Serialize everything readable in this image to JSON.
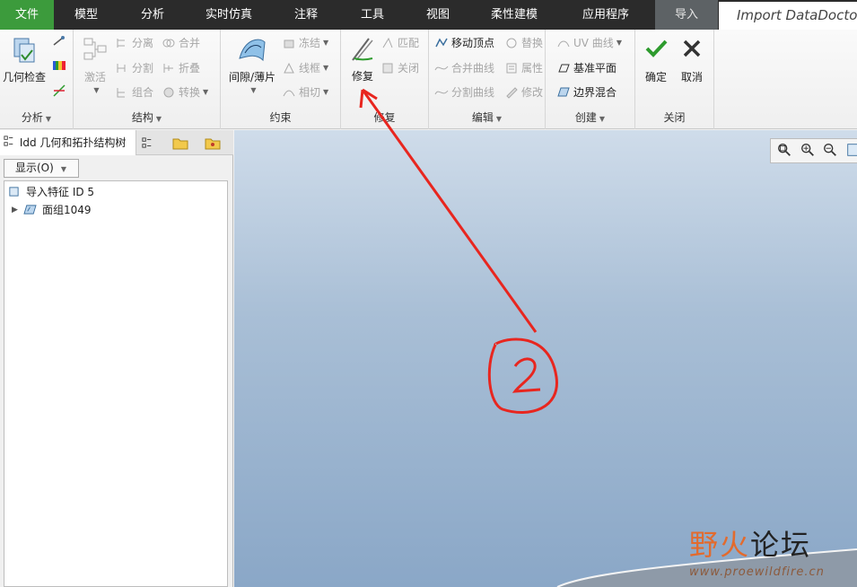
{
  "menu": {
    "tabs": [
      "文件",
      "模型",
      "分析",
      "实时仿真",
      "注释",
      "工具",
      "视图",
      "柔性建模",
      "应用程序",
      "导入"
    ],
    "import_title": "Import DataDoctor"
  },
  "ribbon": {
    "analysis": {
      "label": "分析",
      "geometry_check": "几何检查"
    },
    "structure": {
      "label": "结构",
      "activate": "激活",
      "split": "分离",
      "divide": "分割",
      "combine": "组合",
      "merge": "合并",
      "fold": "折叠",
      "convert": "转换"
    },
    "constraint": {
      "label": "约束",
      "gap": "间隙/薄片",
      "freeze": "冻结",
      "wireframe": "线框",
      "tangent": "相切"
    },
    "repair": {
      "label": "修复",
      "repair": "修复",
      "match": "匹配",
      "close": "关闭"
    },
    "edit": {
      "label": "编辑",
      "move_vertex": "移动顶点",
      "merge_curve": "合并曲线",
      "split_curve": "分割曲线",
      "replace": "替换",
      "properties": "属性",
      "modify": "修改"
    },
    "create": {
      "label": "创建",
      "uv_curve": "UV 曲线",
      "datum_plane": "基准平面",
      "boundary_blend": "边界混合"
    },
    "close": {
      "label": "关闭",
      "ok": "确定",
      "cancel": "取消"
    }
  },
  "left_panel": {
    "tab_label": "Idd 几何和拓扑结构树",
    "display_button": "显示(O)",
    "tree": [
      {
        "label": "导入特征 ID 5"
      },
      {
        "label": "面组1049"
      }
    ]
  },
  "annotation": {
    "number": "2",
    "color": "#e8261f"
  },
  "watermark": {
    "title_a": "野火",
    "title_b": "论坛",
    "url": "www.proewildfire.cn"
  },
  "colors": {
    "file_tab": "#3c9b3c",
    "menubar": "#2b2b2b",
    "accent_check": "#2e9b2e"
  }
}
